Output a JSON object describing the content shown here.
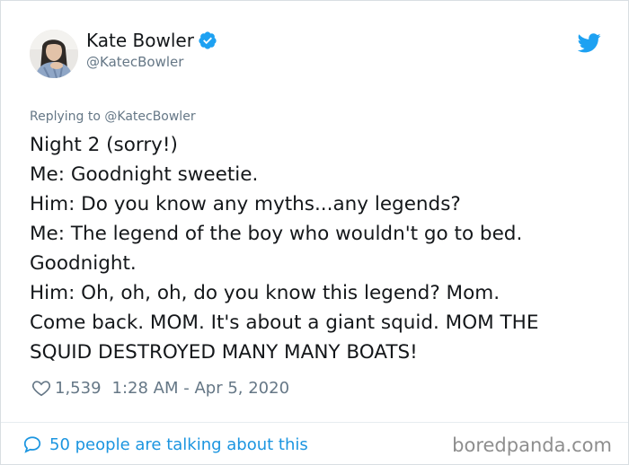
{
  "author": {
    "name": "Kate Bowler",
    "handle": "@KatecBowler",
    "verified_icon": "verified-badge-icon",
    "avatar": "avatar"
  },
  "brand_icon": "twitter-bird-icon",
  "replying_to": "Replying to @KatecBowler",
  "tweet": {
    "lines": [
      "Night 2 (sorry!)",
      "Me: Goodnight sweetie.",
      "Him: Do you know any myths...any legends?",
      "Me: The legend of the boy who wouldn't go to bed.",
      "Goodnight.",
      "Him: Oh, oh, oh, do you know this legend? Mom.",
      "Come back. MOM. It's about a giant squid. MOM THE",
      "SQUID DESTROYED MANY MANY BOATS!"
    ]
  },
  "meta": {
    "likes": "1,539",
    "timestamp": "1:28 AM - Apr 5, 2020",
    "like_icon": "heart-icon"
  },
  "footer": {
    "talking": "50 people are talking about this",
    "talking_icon": "speech-bubble-icon",
    "watermark": "boredpanda.com"
  },
  "colors": {
    "accent": "#1da1f2",
    "link": "#1b95e0",
    "text": "#14171a",
    "muted": "#657786",
    "border": "#d9dee2"
  }
}
